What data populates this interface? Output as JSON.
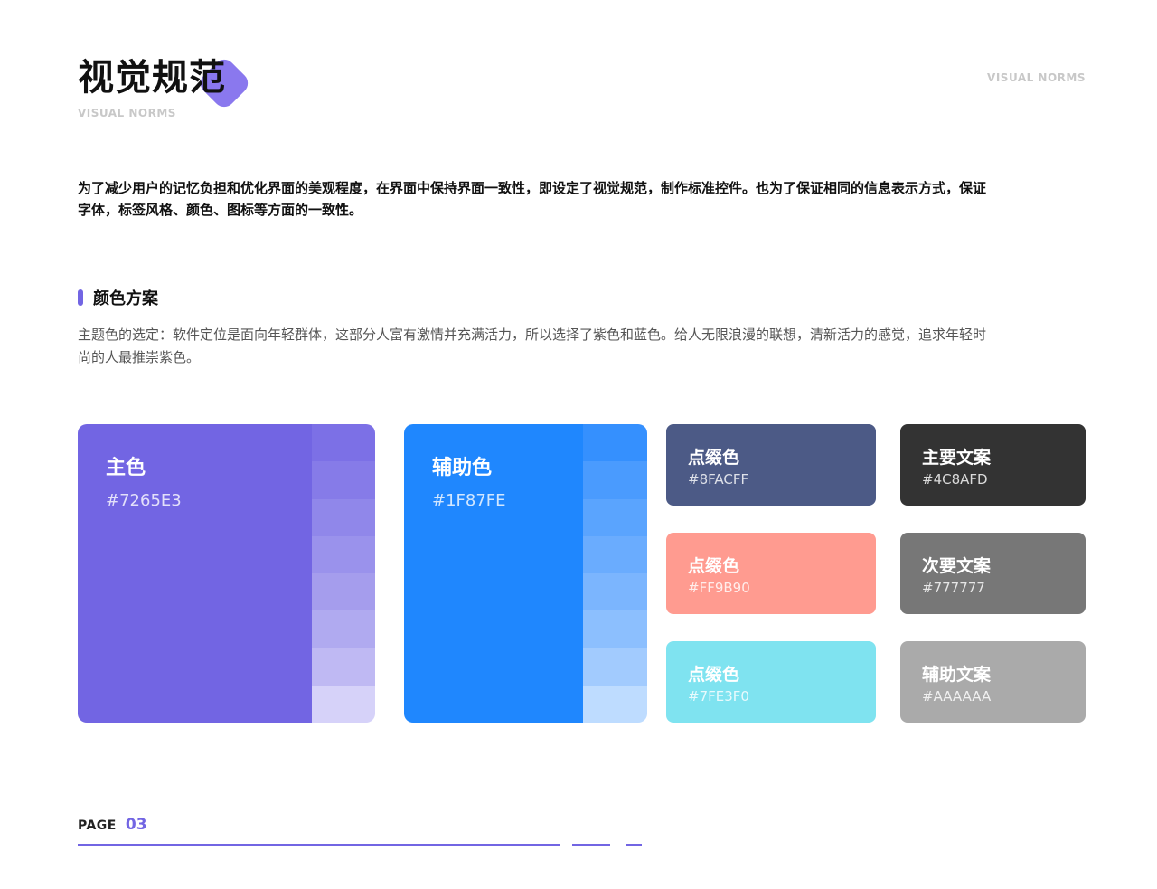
{
  "header": {
    "title": "视觉规范",
    "subtitle": "VISUAL NORMS",
    "right_label": "VISUAL NORMS"
  },
  "intro": "为了减少用户的记忆负担和优化界面的美观程度，在界面中保持界面一致性，即设定了视觉规范，制作标准控件。也为了保证相同的信息表示方式，保证字体，标签风格、颜色、图标等方面的一致性。",
  "section": {
    "title": "颜色方案",
    "description": "主题色的选定：软件定位是面向年轻群体，这部分人富有激情并充满活力，所以选择了紫色和蓝色。给人无限浪漫的联想，清新活力的感觉，追求年轻时尚的人最推崇紫色。"
  },
  "primary": {
    "name": "主色",
    "hex": "#7265E3",
    "color": "#7265e3",
    "shades": [
      "#7c70e6",
      "#867be8",
      "#9087ea",
      "#9a92ec",
      "#a59ded",
      "#b0aaf0",
      "#bfb9f3",
      "#d6d2f9"
    ]
  },
  "secondary": {
    "name": "辅助色",
    "hex": "#1F87FE",
    "color": "#1f87fe",
    "shades": [
      "#3590fe",
      "#4a9bfe",
      "#5aa4fe",
      "#6aacfe",
      "#7bb5fe",
      "#8cbffe",
      "#a2cbfe",
      "#bedcff"
    ]
  },
  "accents": [
    {
      "name": "点缀色",
      "hex": "#8FACFF",
      "color": "#4c5a86"
    },
    {
      "name": "点缀色",
      "hex": "#FF9B90",
      "color": "#ff9b90"
    },
    {
      "name": "点缀色",
      "hex": "#7FE3F0",
      "color": "#7fe3f0"
    }
  ],
  "texts": [
    {
      "name": "主要文案",
      "hex": "#4C8AFD",
      "color": "#333333"
    },
    {
      "name": "次要文案",
      "hex": "#777777",
      "color": "#777777"
    },
    {
      "name": "辅助文案",
      "hex": "#AAAAAA",
      "color": "#aaaaaa"
    }
  ],
  "footer": {
    "page_label": "PAGE",
    "page_number": "03"
  }
}
